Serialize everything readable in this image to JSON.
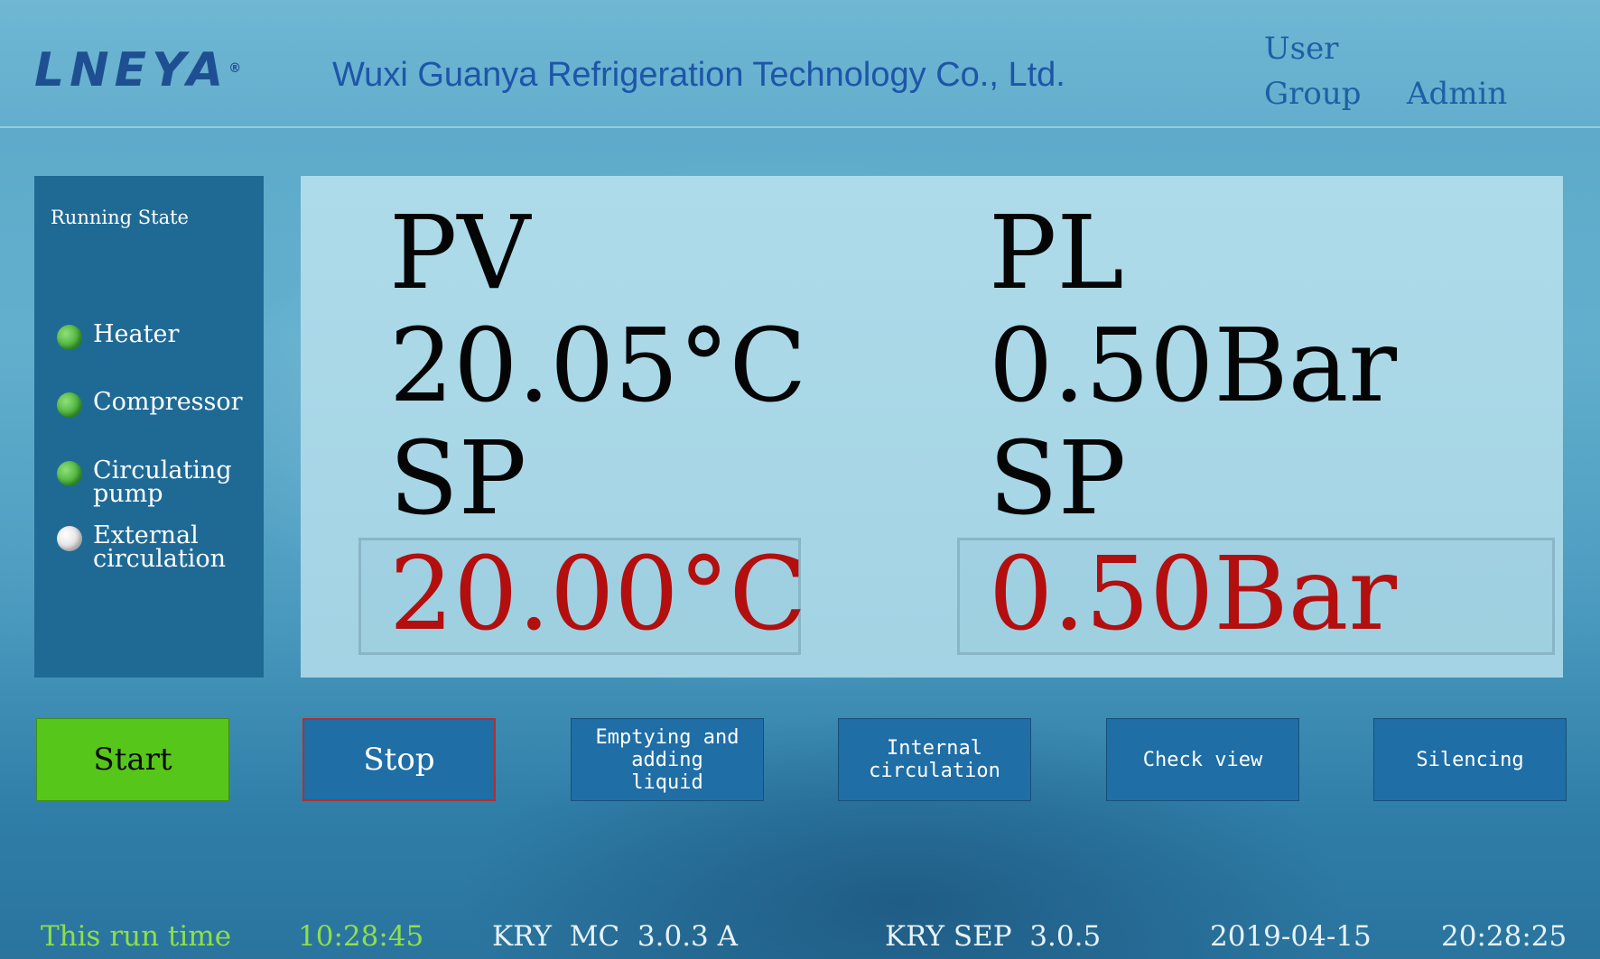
{
  "header": {
    "logo_text": "LNEYA",
    "logo_mark": "®",
    "company": "Wuxi Guanya Refrigeration Technology Co., Ltd.",
    "user_label": "User",
    "group_label": "Group",
    "admin_label": "Admin"
  },
  "running_state": {
    "title": "Running State",
    "items": [
      {
        "label": "Heater",
        "state": "on"
      },
      {
        "label": "Compressor",
        "state": "on"
      },
      {
        "label": "Circulating pump",
        "state": "on"
      },
      {
        "label": "External circulation",
        "state": "off"
      }
    ],
    "colors": {
      "on": "#3aa52c",
      "off": "#ffffff"
    }
  },
  "temperature": {
    "pv_label": "PV",
    "pv_value": "20.05°C",
    "sp_label": "SP",
    "sp_value": "20.00°C"
  },
  "pressure": {
    "pl_label": "PL",
    "pl_value": "0.50Bar",
    "sp_label": "SP",
    "sp_value": "0.50Bar"
  },
  "buttons": {
    "start": "Start",
    "stop": "Stop",
    "emptying": "Emptying and adding liquid",
    "internal": "Internal circulation",
    "check_view": "Check view",
    "silencing": "Silencing"
  },
  "status_bar": {
    "run_time_label": "This run time",
    "run_time_value": "10:28:45",
    "mc_version": "KRY  MC  3.0.3 A",
    "sep_version": "KRY SEP  3.0.5",
    "date": "2019-04-15",
    "time": "20:28:25"
  },
  "colors": {
    "setpoint_red": "#b30f0f",
    "start_green": "#56c61a",
    "button_blue": "#1f6ea6",
    "status_green": "#8de04a"
  }
}
